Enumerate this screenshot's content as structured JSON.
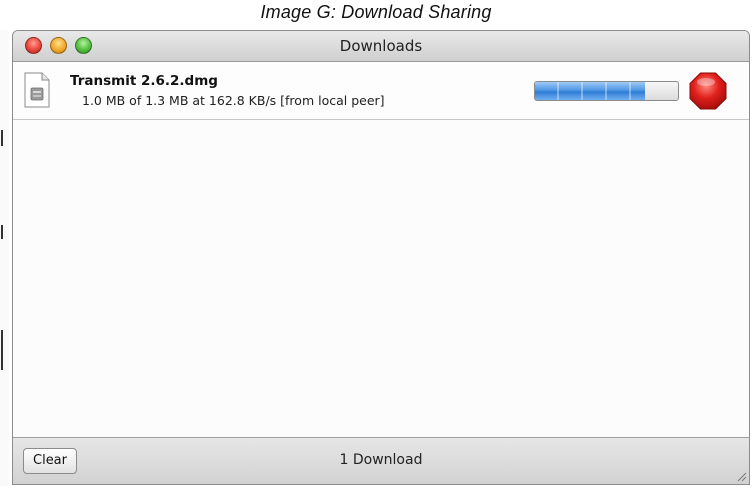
{
  "caption": "Image G:  Download Sharing",
  "window": {
    "title": "Downloads"
  },
  "download": {
    "file_name": "Transmit 2.6.2.dmg",
    "status": "1.0 MB of 1.3 MB at 162.8 KB/s [from local peer]",
    "progress_fraction": 0.77,
    "icon": "disk-image-icon"
  },
  "footer": {
    "clear_label": "Clear",
    "count_text": "1 Download"
  },
  "colors": {
    "stop_button": "#e0201c",
    "progress_blue": "#4f98e6"
  }
}
